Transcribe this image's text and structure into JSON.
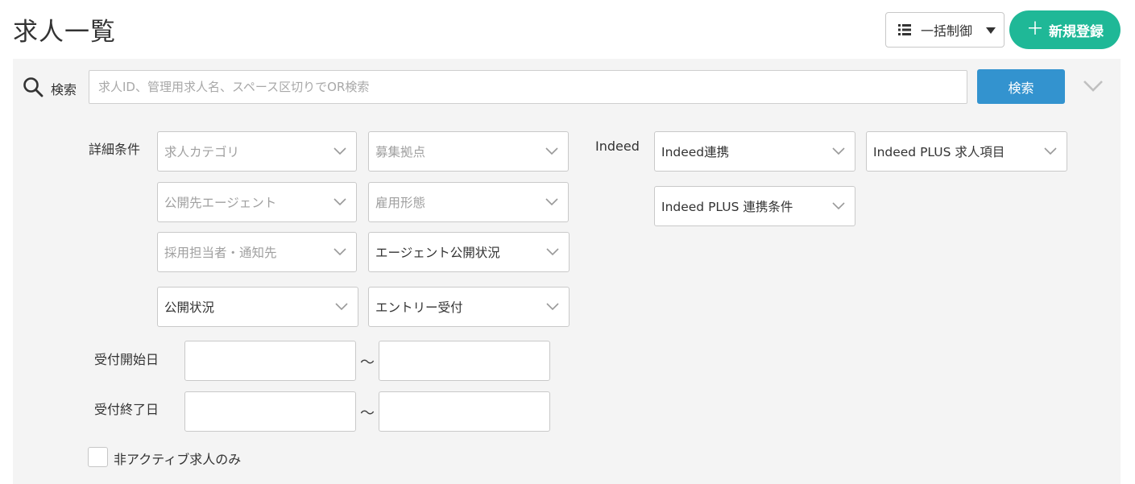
{
  "page": {
    "title": "求人一覧"
  },
  "header": {
    "bulk_control_label": "一括制御",
    "new_register_label": "新規登録",
    "new_register_color": "#1fb897"
  },
  "search": {
    "label": "検索",
    "placeholder": "求人ID、管理用求人名、スペース区切りでOR検索",
    "value": "",
    "button_label": "検索",
    "button_color": "#3393cf"
  },
  "filters": {
    "detail_label": "詳細条件",
    "indeed_label": "Indeed",
    "detail_selects": [
      {
        "label": "求人カテゴリ",
        "placeholder": true
      },
      {
        "label": "募集拠点",
        "placeholder": true
      },
      {
        "label": "公開先エージェント",
        "placeholder": true
      },
      {
        "label": "雇用形態",
        "placeholder": true
      },
      {
        "label": "採用担当者・通知先",
        "placeholder": true
      },
      {
        "label": "エージェント公開状況",
        "placeholder": false
      },
      {
        "label": "公開状況",
        "placeholder": false
      },
      {
        "label": "エントリー受付",
        "placeholder": false
      }
    ],
    "indeed_selects": [
      {
        "label": "Indeed連携",
        "placeholder": false
      },
      {
        "label": "Indeed PLUS 求人項目",
        "placeholder": false
      },
      {
        "label": "Indeed PLUS 連携条件",
        "placeholder": false
      }
    ],
    "dates": {
      "start_label": "受付開始日",
      "end_label": "受付終了日",
      "range_separator": "～",
      "start_from": "",
      "start_to": "",
      "end_from": "",
      "end_to": ""
    },
    "inactive_only": {
      "label": "非アクティブ求人のみ",
      "checked": false
    }
  }
}
